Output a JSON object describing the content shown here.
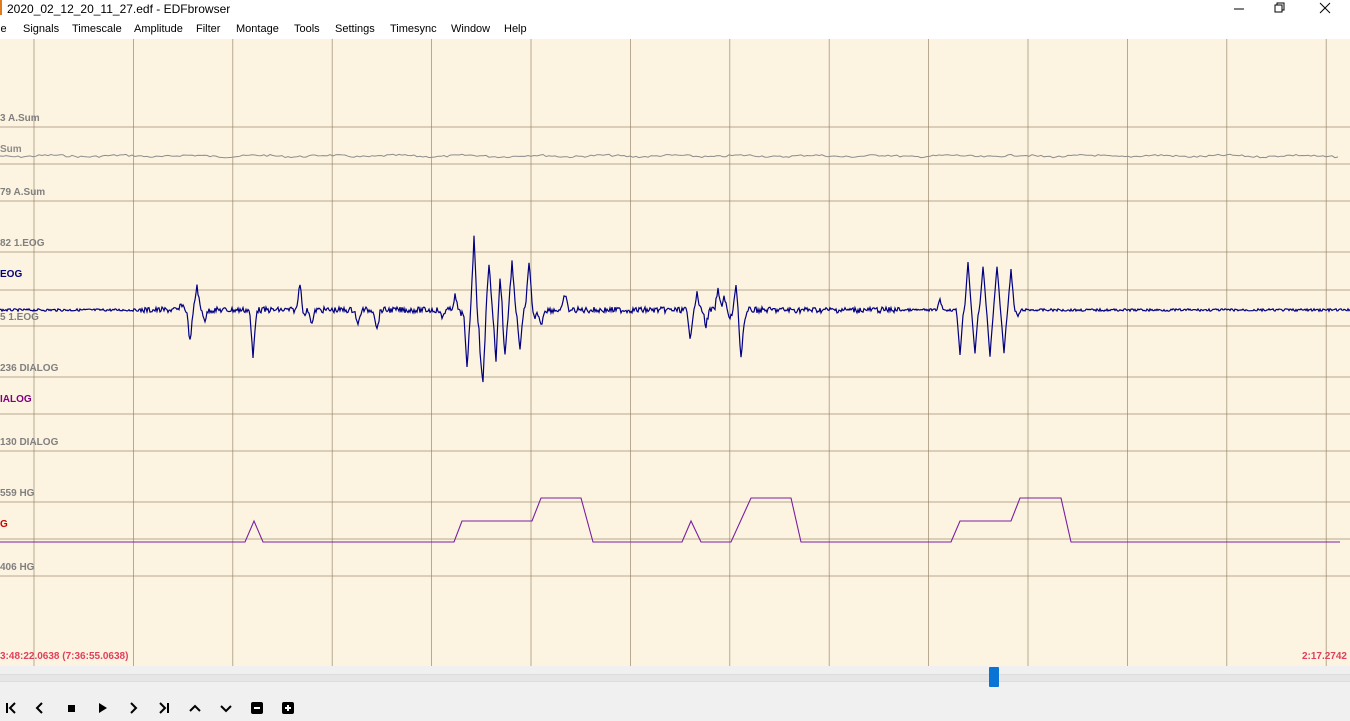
{
  "window": {
    "title": "2020_02_12_20_11_27.edf - EDFbrowser",
    "accent_color": "#e07a1f"
  },
  "menu": [
    {
      "id": "file",
      "label": "le"
    },
    {
      "id": "signals",
      "label": "Signals"
    },
    {
      "id": "timescale",
      "label": "Timescale"
    },
    {
      "id": "amplitude",
      "label": "Amplitude"
    },
    {
      "id": "filter",
      "label": "Filter"
    },
    {
      "id": "montage",
      "label": "Montage"
    },
    {
      "id": "tools",
      "label": "Tools"
    },
    {
      "id": "settings",
      "label": "Settings"
    },
    {
      "id": "timesync",
      "label": "Timesync"
    },
    {
      "id": "window",
      "label": "Window"
    },
    {
      "id": "help",
      "label": "Help"
    }
  ],
  "signals": [
    {
      "top_label": "3 A.Sum",
      "name_label": "Sum",
      "bottom_label": "79 A.Sum",
      "color": "#8c8c8c"
    },
    {
      "top_label": "82 1.EOG",
      "name_label": "EOG",
      "bottom_label": "5 1.EOG",
      "color": "#000080"
    },
    {
      "top_label": "236 DIALOG",
      "name_label": "IALOG",
      "bottom_label": "130 DIALOG",
      "color": "#800080"
    },
    {
      "top_label": "559 HG",
      "name_label": "G",
      "bottom_label": "406 HG",
      "color": "#cc0000"
    }
  ],
  "timebar": {
    "left": "3:48:22.0638 (7:36:55.0638)",
    "right": "2:17.2742",
    "color": "#e0405c"
  },
  "colors": {
    "background": "#fdf3e1",
    "grid": "#8a7a5a",
    "eog_trace": "#000080",
    "hg_trace": "#7a1fa0",
    "sum_trace": "#8c8c8c",
    "scroll_handle": "#0a74d6"
  },
  "nav_buttons": [
    "skip-first-icon",
    "prev-icon",
    "stop-icon",
    "play-icon",
    "next-icon",
    "skip-last-icon",
    "up-icon",
    "down-icon",
    "minus-icon",
    "plus-icon"
  ]
}
